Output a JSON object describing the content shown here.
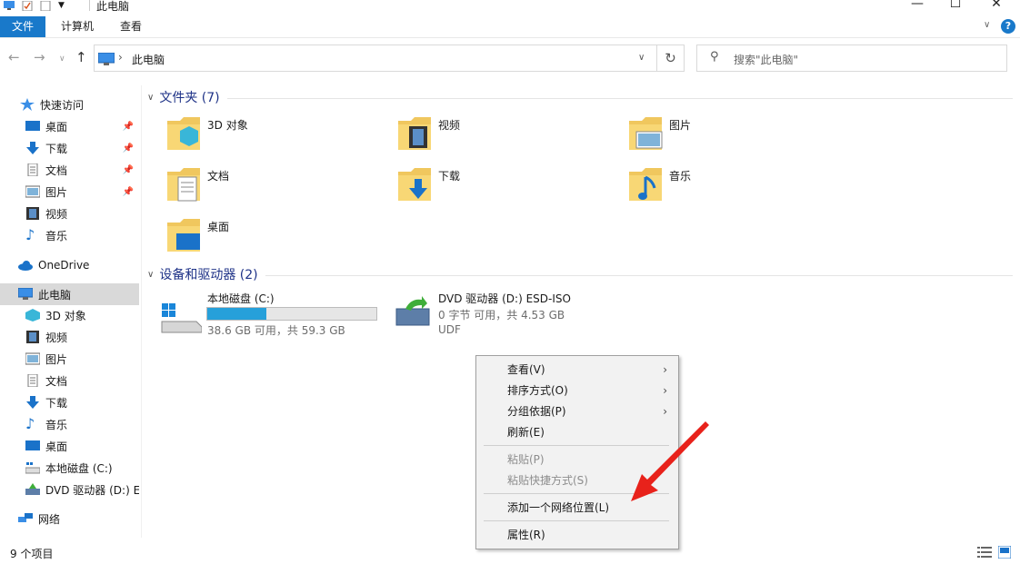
{
  "window": {
    "title": "此电脑"
  },
  "ribbon": {
    "tabs": [
      "文件",
      "计算机",
      "查看"
    ]
  },
  "address": {
    "path": "此电脑",
    "search_placeholder": "搜索\"此电脑\""
  },
  "sidebar": {
    "items": [
      {
        "label": "快速访问",
        "icon": "star-icon",
        "pinned": false
      },
      {
        "label": "桌面",
        "icon": "desktop-icon",
        "pinned": true
      },
      {
        "label": "下载",
        "icon": "download-icon",
        "pinned": true
      },
      {
        "label": "文档",
        "icon": "document-icon",
        "pinned": true
      },
      {
        "label": "图片",
        "icon": "picture-icon",
        "pinned": true
      },
      {
        "label": "视频",
        "icon": "video-icon",
        "pinned": false
      },
      {
        "label": "音乐",
        "icon": "music-icon",
        "pinned": false
      },
      {
        "label": "OneDrive",
        "icon": "cloud-icon",
        "pinned": false
      },
      {
        "label": "此电脑",
        "icon": "computer-icon",
        "pinned": false,
        "selected": true
      },
      {
        "label": "3D 对象",
        "icon": "cube-icon"
      },
      {
        "label": "视频",
        "icon": "video-icon"
      },
      {
        "label": "图片",
        "icon": "picture-icon"
      },
      {
        "label": "文档",
        "icon": "document-icon"
      },
      {
        "label": "下载",
        "icon": "download-icon"
      },
      {
        "label": "音乐",
        "icon": "music-icon"
      },
      {
        "label": "桌面",
        "icon": "desktop-icon"
      },
      {
        "label": "本地磁盘 (C:)",
        "icon": "drive-icon"
      },
      {
        "label": "DVD 驱动器 (D:) ES",
        "icon": "dvd-icon"
      },
      {
        "label": "网络",
        "icon": "network-icon"
      }
    ]
  },
  "main": {
    "folders_title": "文件夹 (7)",
    "folders": [
      "3D 对象",
      "视频",
      "图片",
      "文档",
      "下载",
      "音乐",
      "桌面"
    ],
    "devices_title": "设备和驱动器 (2)",
    "drives": [
      {
        "name": "本地磁盘 (C:)",
        "free_text": "38.6 GB 可用，共 59.3 GB",
        "used_fraction": 0.35
      },
      {
        "name": "DVD 驱动器 (D:) ESD-ISO",
        "free_text": "0 字节 可用，共 4.53 GB",
        "fs": "UDF"
      }
    ]
  },
  "context_menu": {
    "items": [
      {
        "label": "查看(V)",
        "submenu": true,
        "disabled": false
      },
      {
        "label": "排序方式(O)",
        "submenu": true,
        "disabled": false
      },
      {
        "label": "分组依据(P)",
        "submenu": true,
        "disabled": false
      },
      {
        "label": "刷新(E)",
        "submenu": false,
        "disabled": false
      },
      {
        "label": "粘贴(P)",
        "submenu": false,
        "disabled": true
      },
      {
        "label": "粘贴快捷方式(S)",
        "submenu": false,
        "disabled": true
      },
      {
        "label": "添加一个网络位置(L)",
        "submenu": false,
        "disabled": false
      },
      {
        "label": "属性(R)",
        "submenu": false,
        "disabled": false
      }
    ]
  },
  "status": {
    "count": "9 个项目"
  },
  "colors": {
    "accent": "#1979ca",
    "section_title": "#1e3287",
    "drive_bar": "#26a0da",
    "annotation_arrow": "#e8221b"
  }
}
